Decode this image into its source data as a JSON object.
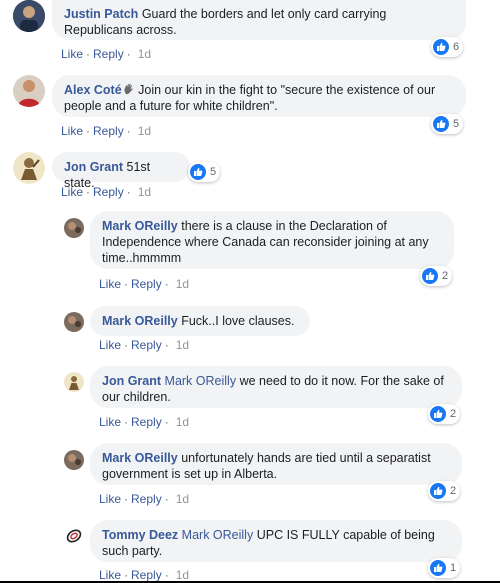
{
  "actions": {
    "like": "Like",
    "reply": "Reply",
    "sep": "·"
  },
  "comments": [
    {
      "name": "Justin Patch",
      "text": "Guard the borders and let only card carrying Republicans across.",
      "time": "1d",
      "likes": "6"
    },
    {
      "name": "Alex Coté",
      "name_icon": "wave-hand-icon",
      "text": "Join our kin in the fight to \"secure the existence of our people and a future for white children\".",
      "time": "1d",
      "likes": "5"
    },
    {
      "name": "Jon Grant",
      "text": "51st state.",
      "time": "1d",
      "likes": "5"
    }
  ],
  "replies": [
    {
      "name": "Mark OReilly",
      "text": "there is a clause in the Declaration of Independence where Canada can reconsider joining at any time..hmmmm",
      "time": "1d",
      "likes": "2"
    },
    {
      "name": "Mark OReilly",
      "text": "Fuck..I love clauses.",
      "time": "1d"
    },
    {
      "name": "Jon Grant",
      "mention": "Mark OReilly",
      "text": "we need to do it now. For the sake of our children.",
      "time": "1d",
      "likes": "2"
    },
    {
      "name": "Mark OReilly",
      "text": "unfortunately hands are tied until a separatist government is set up in Alberta.",
      "time": "1d",
      "likes": "2"
    },
    {
      "name": "Tommy Deez",
      "mention": "Mark OReilly",
      "text": "UPC IS FULLY capable of being such party.",
      "time": "1d",
      "likes": "1"
    }
  ],
  "colors": {
    "name": "#385898",
    "bubble": "#f2f3f5",
    "like_blue": "#1877f2"
  }
}
